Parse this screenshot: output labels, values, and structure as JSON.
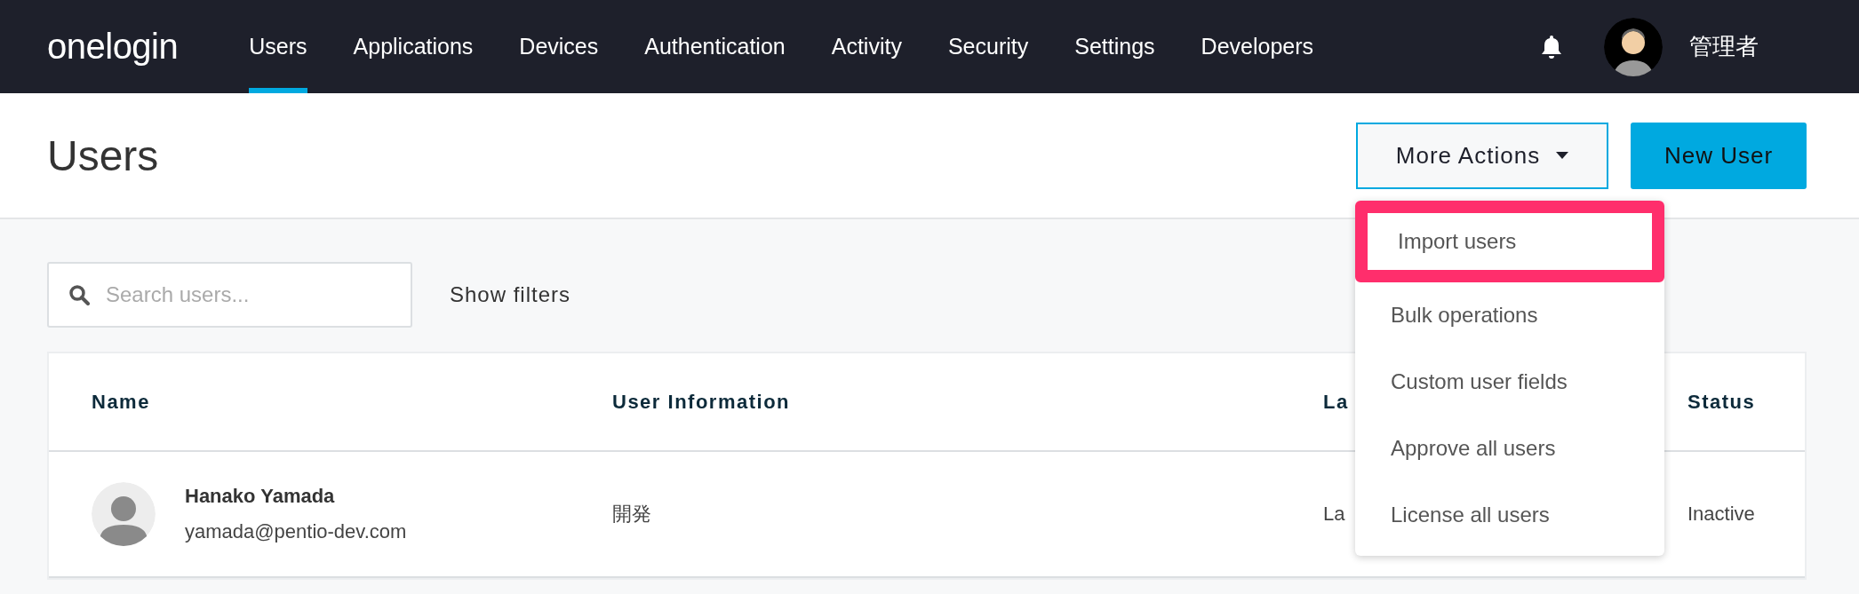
{
  "nav": {
    "logo": "onelogin",
    "items": [
      {
        "label": "Users",
        "selected": true
      },
      {
        "label": "Applications",
        "selected": false
      },
      {
        "label": "Devices",
        "selected": false
      },
      {
        "label": "Authentication",
        "selected": false
      },
      {
        "label": "Activity",
        "selected": false
      },
      {
        "label": "Security",
        "selected": false
      },
      {
        "label": "Settings",
        "selected": false
      },
      {
        "label": "Developers",
        "selected": false
      }
    ],
    "user_name": "管理者"
  },
  "header": {
    "title": "Users",
    "more_actions": "More Actions",
    "new_user": "New User"
  },
  "dropdown": {
    "items": [
      {
        "label": "Import users",
        "highlighted": true
      },
      {
        "label": "Bulk operations",
        "highlighted": false
      },
      {
        "label": "Custom user fields",
        "highlighted": false
      },
      {
        "label": "Approve all users",
        "highlighted": false
      },
      {
        "label": "License all users",
        "highlighted": false
      }
    ]
  },
  "search": {
    "placeholder": "Search users..."
  },
  "show_filters": "Show filters",
  "table": {
    "columns": [
      "Name",
      "User Information",
      "La",
      "Status"
    ],
    "rows": [
      {
        "name": "Hanako Yamada",
        "email": "yamada@pentio-dev.com",
        "info": "開発",
        "column_3": "La",
        "status": "Inactive"
      }
    ]
  }
}
